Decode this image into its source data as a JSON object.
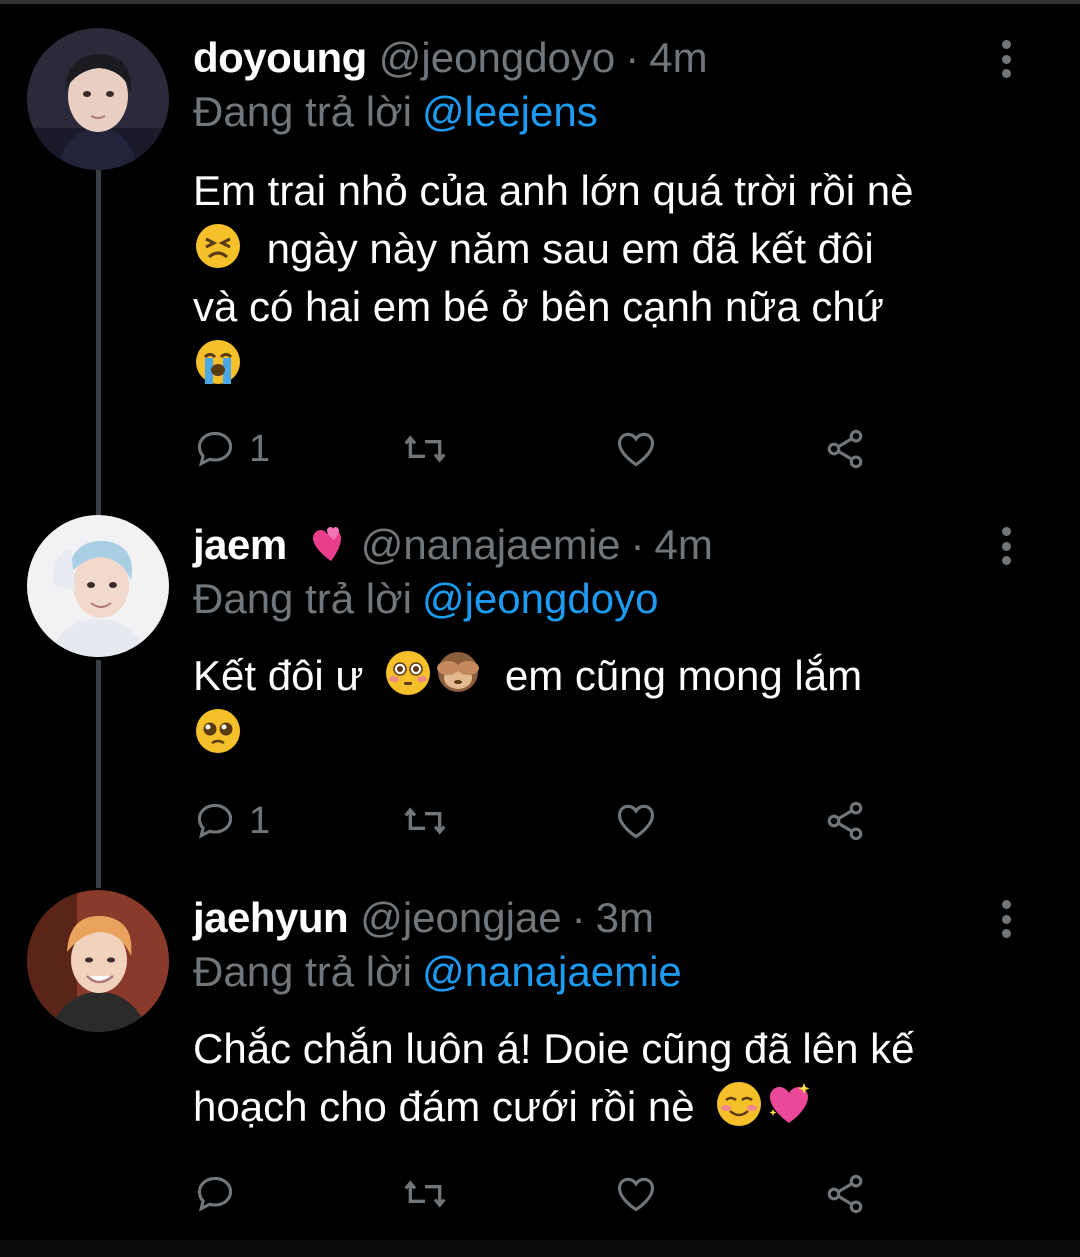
{
  "colors": {
    "background": "#000000",
    "secondary_text": "#71767b",
    "mention": "#1d9bf0",
    "thread_line": "#3a3f44"
  },
  "tweets": [
    {
      "display_name": "doyoung",
      "name_emoji": "",
      "handle": "@jeongdoyo",
      "separator": "·",
      "time": "4m",
      "reply_prefix": "Đang trả lời",
      "reply_to": "@leejens",
      "text_parts": [
        "Em trai nhỏ của anh lớn quá trời rồi nè",
        "ngày này năm sau em đã kết đôi",
        "và có hai em bé ở bên cạnh nữa chứ"
      ],
      "emojis": [
        "tired-face-emoji",
        "loudly-crying-face-emoji"
      ],
      "reply_count": "1"
    },
    {
      "display_name": "jaem",
      "name_emoji": "two-hearts-emoji",
      "handle": "@nanajaemie",
      "separator": "·",
      "time": "4m",
      "reply_prefix": "Đang trả lời",
      "reply_to": "@jeongdoyo",
      "text_parts": [
        "Kết đôi ư",
        "em cũng mong lắm"
      ],
      "emojis": [
        "flushed-face-emoji",
        "see-no-evil-monkey-emoji",
        "pleading-face-emoji"
      ],
      "reply_count": "1"
    },
    {
      "display_name": "jaehyun",
      "name_emoji": "",
      "handle": "@jeongjae",
      "separator": "·",
      "time": "3m",
      "reply_prefix": "Đang trả lời",
      "reply_to": "@nanajaemie",
      "text_parts": [
        "Chắc chắn luôn á! Doie cũng đã lên kế",
        "hoạch cho đám cưới rồi nè"
      ],
      "emojis": [
        "smiling-face-emoji",
        "sparkling-heart-emoji"
      ],
      "reply_count": ""
    }
  ]
}
